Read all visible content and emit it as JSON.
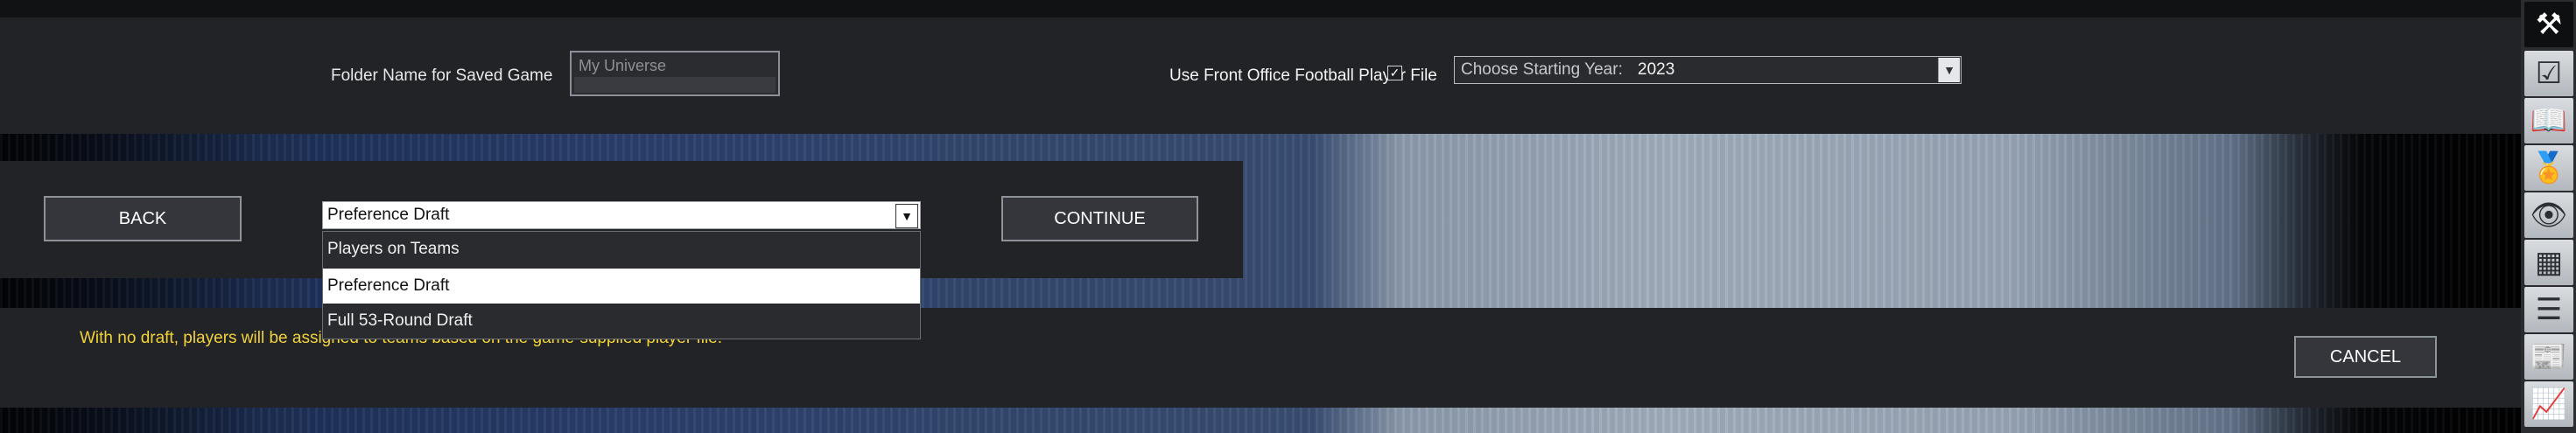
{
  "folder": {
    "label": "Folder Name for Saved Game",
    "placeholder": "My Universe"
  },
  "player_file": {
    "label": "Use Front Office Football Player File",
    "checked": true,
    "check_glyph": "✓"
  },
  "year_select": {
    "label": "Choose Starting Year:",
    "value": "2023",
    "arrow": "▼"
  },
  "buttons": {
    "back": "BACK",
    "continue": "CONTINUE",
    "cancel": "CANCEL"
  },
  "draft_select": {
    "value": "Preference Draft",
    "arrow": "▼",
    "options": [
      "Players on Teams",
      "Preference Draft",
      "Full 53-Round Draft"
    ],
    "selected_index": 1
  },
  "info_text": "With no draft, players will be assigned to teams based on the game-supplied player file.",
  "rail_icons": [
    {
      "name": "tools-icon",
      "glyph": "⚒"
    },
    {
      "name": "checklist-icon",
      "glyph": "☑"
    },
    {
      "name": "book-icon",
      "glyph": "📖"
    },
    {
      "name": "medal-icon",
      "glyph": "🏅"
    },
    {
      "name": "eye-icon",
      "glyph": "👁"
    },
    {
      "name": "grid-icon",
      "glyph": "▦"
    },
    {
      "name": "list-icon",
      "glyph": "☰"
    },
    {
      "name": "newspaper-icon",
      "glyph": "📰"
    },
    {
      "name": "chart-icon",
      "glyph": "📈"
    }
  ],
  "colors": {
    "info_text": "#f2d23a",
    "background": "#222326"
  }
}
